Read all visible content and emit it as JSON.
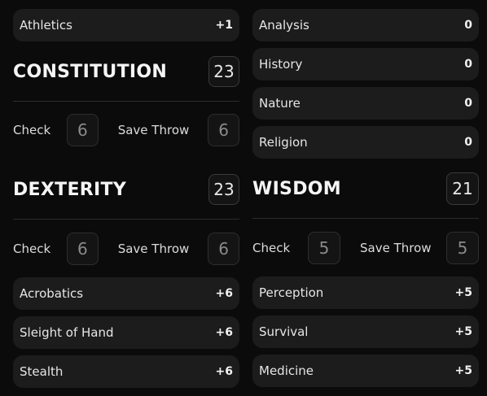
{
  "left": {
    "top_skill": {
      "label": "Athletics",
      "mod": "+1"
    },
    "constitution": {
      "name": "CONSTITUTION",
      "score": "23",
      "check_label": "Check",
      "check_value": "6",
      "save_label": "Save Throw",
      "save_value": "6"
    },
    "dexterity": {
      "name": "DEXTERITY",
      "score": "23",
      "check_label": "Check",
      "check_value": "6",
      "save_label": "Save Throw",
      "save_value": "6",
      "skills": [
        {
          "label": "Acrobatics",
          "mod": "+6"
        },
        {
          "label": "Sleight of Hand",
          "mod": "+6"
        },
        {
          "label": "Stealth",
          "mod": "+6"
        }
      ]
    }
  },
  "right": {
    "int_skills": [
      {
        "label": "Analysis",
        "mod": "0"
      },
      {
        "label": "History",
        "mod": "0"
      },
      {
        "label": "Nature",
        "mod": "0"
      },
      {
        "label": "Religion",
        "mod": "0"
      }
    ],
    "wisdom": {
      "name": "WISDOM",
      "score": "21",
      "check_label": "Check",
      "check_value": "5",
      "save_label": "Save Throw",
      "save_value": "5",
      "skills": [
        {
          "label": "Perception",
          "mod": "+5"
        },
        {
          "label": "Survival",
          "mod": "+5"
        },
        {
          "label": "Medicine",
          "mod": "+5"
        }
      ]
    }
  }
}
